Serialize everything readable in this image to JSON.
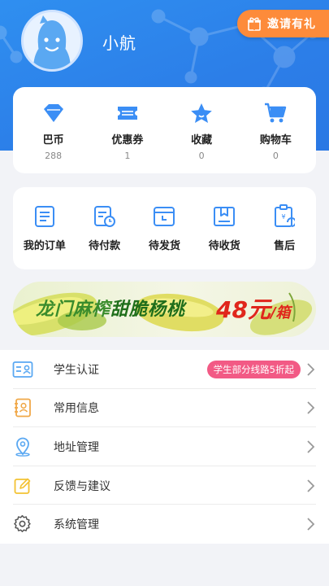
{
  "header": {
    "username": "小航",
    "invite_label": "邀请有礼"
  },
  "stats": [
    {
      "label": "巴币",
      "count": "288",
      "icon": "diamond-icon"
    },
    {
      "label": "优惠券",
      "count": "1",
      "icon": "coupon-icon"
    },
    {
      "label": "收藏",
      "count": "0",
      "icon": "star-icon"
    },
    {
      "label": "购物车",
      "count": "0",
      "icon": "cart-icon"
    }
  ],
  "orders": [
    {
      "label": "我的订单",
      "icon": "order-list-icon"
    },
    {
      "label": "待付款",
      "icon": "pending-payment-icon"
    },
    {
      "label": "待发货",
      "icon": "pending-shipment-icon"
    },
    {
      "label": "待收货",
      "icon": "pending-receipt-icon"
    },
    {
      "label": "售后",
      "icon": "after-sales-icon"
    }
  ],
  "banner": {
    "title_part1": "龙门麻榨",
    "title_part2": "甜脆杨桃",
    "price": "48元",
    "unit": "/箱"
  },
  "menu": [
    {
      "label": "学生认证",
      "badge": "学生部分线路5折起",
      "icon": "student-id-icon"
    },
    {
      "label": "常用信息",
      "icon": "contacts-icon"
    },
    {
      "label": "地址管理",
      "icon": "location-icon"
    },
    {
      "label": "反馈与建议",
      "icon": "feedback-edit-icon"
    },
    {
      "label": "系统管理",
      "icon": "settings-gear-icon"
    }
  ],
  "colors": {
    "header_blue": "#2c7ee8",
    "icon_blue": "#3b8ef5",
    "invite_orange": "#fd8b3a",
    "badge_pink": "#f25a85",
    "price_red": "#e0261c"
  }
}
